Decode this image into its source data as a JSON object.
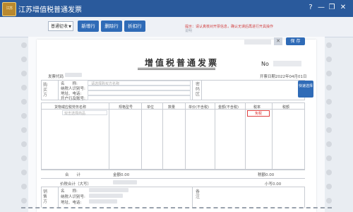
{
  "window": {
    "logo_text": "江苏",
    "title": "江苏增值税普通发票",
    "controls": [
      "?",
      "—",
      "❐",
      "✕"
    ]
  },
  "toolbar": {
    "invoice_type": "普通征收",
    "buttons": [
      "新增行",
      "删除行",
      "折扣行"
    ],
    "notice": "提示：请认真核对开票信息，确认无误后再进行开具操作",
    "hint": "说明"
  },
  "invoice": {
    "title": "增值税普通发票",
    "no_label": "No",
    "code_label": "发票代码",
    "date_label": "开票日期2022年04月01日",
    "buyer_section": "购买方",
    "buyer_fields": [
      "名　　称:",
      "纳税人识别号:",
      "地址、电话:",
      "开户行及账号:"
    ],
    "buyer_placeholder": "请选择购买方名称",
    "password_area": "密码区",
    "columns": [
      "货物或应税劳务名称",
      "规格型号",
      "单位",
      "数量",
      "单价(不含税)",
      "金额(不含税)",
      "税率",
      "税额"
    ],
    "goods_placeholder": "双击选择商品",
    "tax_rate": "免税",
    "side_button": "快速选择",
    "close": "✕",
    "save": "保 存",
    "total_label": "合　　计",
    "total_amount": "金额0.00",
    "total_tax": "税额0.00",
    "grand_total_label": "价税合计（大写）",
    "grand_total_small": "小写0.00",
    "seller_section": "销售方",
    "seller_fields": [
      "名　　称:",
      "纳税人识别号:",
      "地址、电话:"
    ],
    "remarks": "备注"
  }
}
